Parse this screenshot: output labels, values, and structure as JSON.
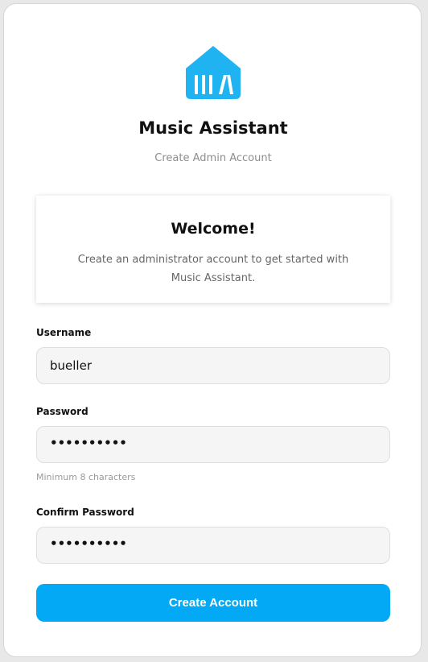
{
  "app": {
    "title": "Music Assistant",
    "subtitle": "Create Admin Account",
    "logo_icon": "music-assistant-logo-icon",
    "brand_color": "#1fb3f2"
  },
  "welcome": {
    "title": "Welcome!",
    "message": "Create an administrator account to get started with Music Assistant."
  },
  "form": {
    "username": {
      "label": "Username",
      "value": "bueller"
    },
    "password": {
      "label": "Password",
      "masked_value": "••••••••••",
      "hint": "Minimum 8 characters"
    },
    "confirm_password": {
      "label": "Confirm Password",
      "masked_value": "••••••••••"
    },
    "submit_label": "Create Account",
    "submit_color": "#03a9f4"
  }
}
